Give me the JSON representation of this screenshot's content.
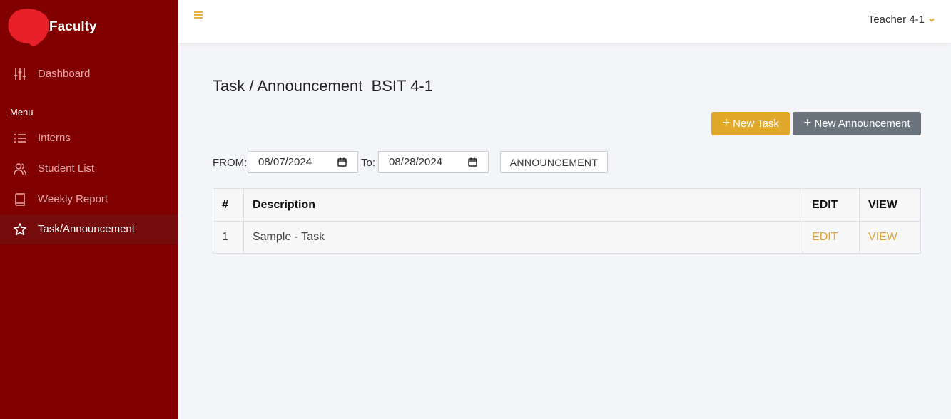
{
  "sidebar": {
    "brand": "Faculty",
    "dashboard_label": "Dashboard",
    "menu_heading": "Menu",
    "items": [
      {
        "label": "Interns",
        "icon": "list-icon"
      },
      {
        "label": "Student List",
        "icon": "users-icon"
      },
      {
        "label": "Weekly Report",
        "icon": "book-icon"
      },
      {
        "label": "Task/Announcement",
        "icon": "star-icon",
        "active": true
      }
    ]
  },
  "topbar": {
    "user_name": "Teacher 4-1"
  },
  "page": {
    "title": "Task / Announcement  BSIT 4-1",
    "new_task_label": "New Task",
    "new_announcement_label": "New Announcement"
  },
  "filter": {
    "from_label": "FROM:",
    "from_value": "08/07/2024",
    "to_label": "To:",
    "to_value": "08/28/2024",
    "type_button": "ANNOUNCEMENT"
  },
  "table": {
    "headers": [
      "#",
      "Description",
      "EDIT",
      "VIEW"
    ],
    "rows": [
      {
        "num": "1",
        "description": "Sample - Task",
        "edit": "EDIT",
        "view": "VIEW"
      }
    ]
  },
  "colors": {
    "sidebar": "#800000",
    "accent": "#e0a92c",
    "secondary_button": "#6b737c",
    "link": "#dca43c"
  }
}
